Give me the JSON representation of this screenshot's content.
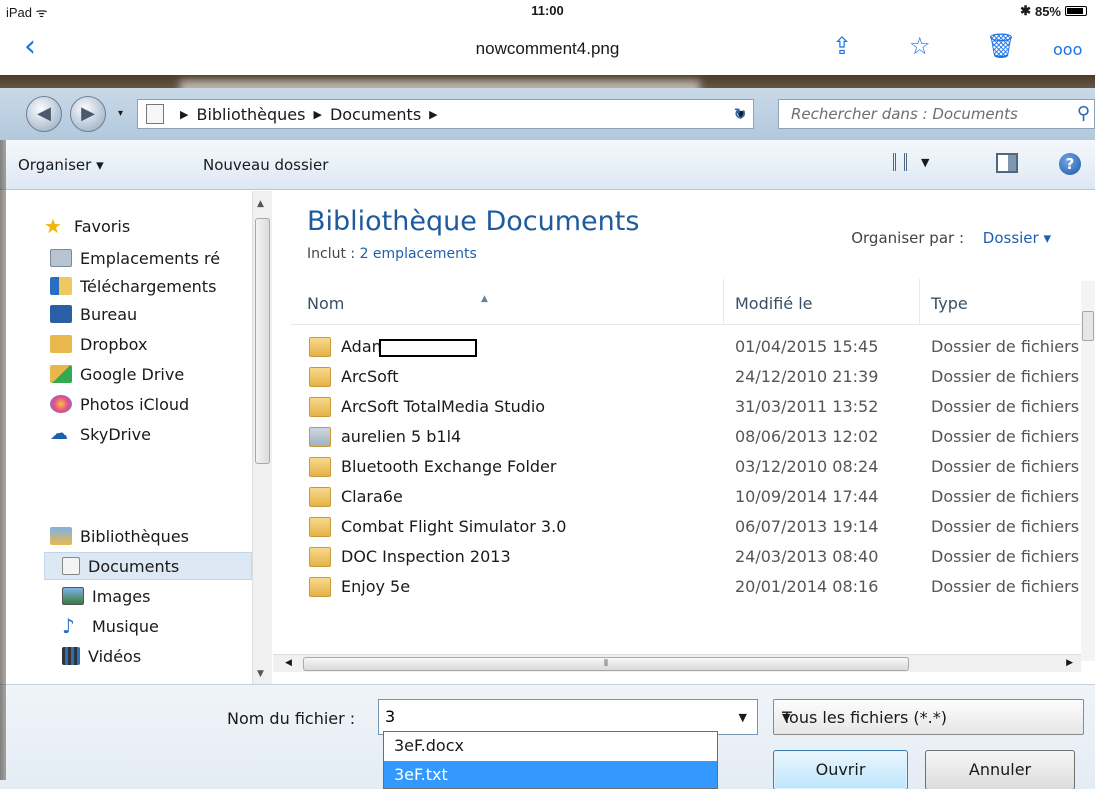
{
  "status_bar": {
    "device": "iPad",
    "time": "11:00",
    "battery": "85%"
  },
  "ipad_nav": {
    "title": "nowcomment4.png"
  },
  "address": {
    "crumbs": [
      "Bibliothèques",
      "Documents"
    ],
    "search_placeholder": "Rechercher dans : Documents"
  },
  "toolbar": {
    "organize": "Organiser ▾",
    "new_folder": "Nouveau dossier"
  },
  "sidebar": {
    "favorites_header": "Favoris",
    "favorites": [
      "Emplacements ré",
      "Téléchargements",
      "Bureau",
      "Dropbox",
      "Google Drive",
      "Photos iCloud",
      "SkyDrive"
    ],
    "libraries_header": "Bibliothèques",
    "libraries": [
      "Documents",
      "Images",
      "Musique",
      "Vidéos"
    ],
    "selected": "Documents"
  },
  "library": {
    "title": "Bibliothèque Documents",
    "includes_label": "Inclut :",
    "includes_link": "2 emplacements",
    "arrange_label": "Organiser par :",
    "arrange_value": "Dossier ▾"
  },
  "columns": {
    "name": "Nom",
    "modified": "Modifié le",
    "type": "Type"
  },
  "files": [
    {
      "name": "Adam C",
      "date": "01/04/2015 15:45",
      "type": "Dossier de fichiers"
    },
    {
      "name": "ArcSoft",
      "date": "24/12/2010 21:39",
      "type": "Dossier de fichiers"
    },
    {
      "name": "ArcSoft TotalMedia Studio",
      "date": "31/03/2011 13:52",
      "type": "Dossier de fichiers"
    },
    {
      "name": "aurelien 5  b1l4",
      "date": "08/06/2013 12:02",
      "type": "Dossier de fichiers"
    },
    {
      "name": "Bluetooth Exchange Folder",
      "date": "03/12/2010 08:24",
      "type": "Dossier de fichiers"
    },
    {
      "name": "Clara6e",
      "date": "10/09/2014 17:44",
      "type": "Dossier de fichiers"
    },
    {
      "name": "Combat Flight Simulator 3.0",
      "date": "06/07/2013 19:14",
      "type": "Dossier de fichiers"
    },
    {
      "name": "DOC Inspection 2013",
      "date": "24/03/2013 08:40",
      "type": "Dossier de fichiers"
    },
    {
      "name": "Enjoy 5e",
      "date": "20/01/2014 08:16",
      "type": "Dossier de fichiers"
    }
  ],
  "bottom": {
    "filename_label": "Nom du fichier :",
    "filename_value": "3",
    "filetype": "Tous les fichiers (*.*)",
    "open_button": "Ouvrir",
    "cancel_button": "Annuler",
    "suggestions": [
      "3eF.docx",
      "3eF.txt"
    ]
  },
  "colors": {
    "accent": "#1f5fb0",
    "title_blue": "#1e5a9c",
    "selection": "#3399ff"
  }
}
